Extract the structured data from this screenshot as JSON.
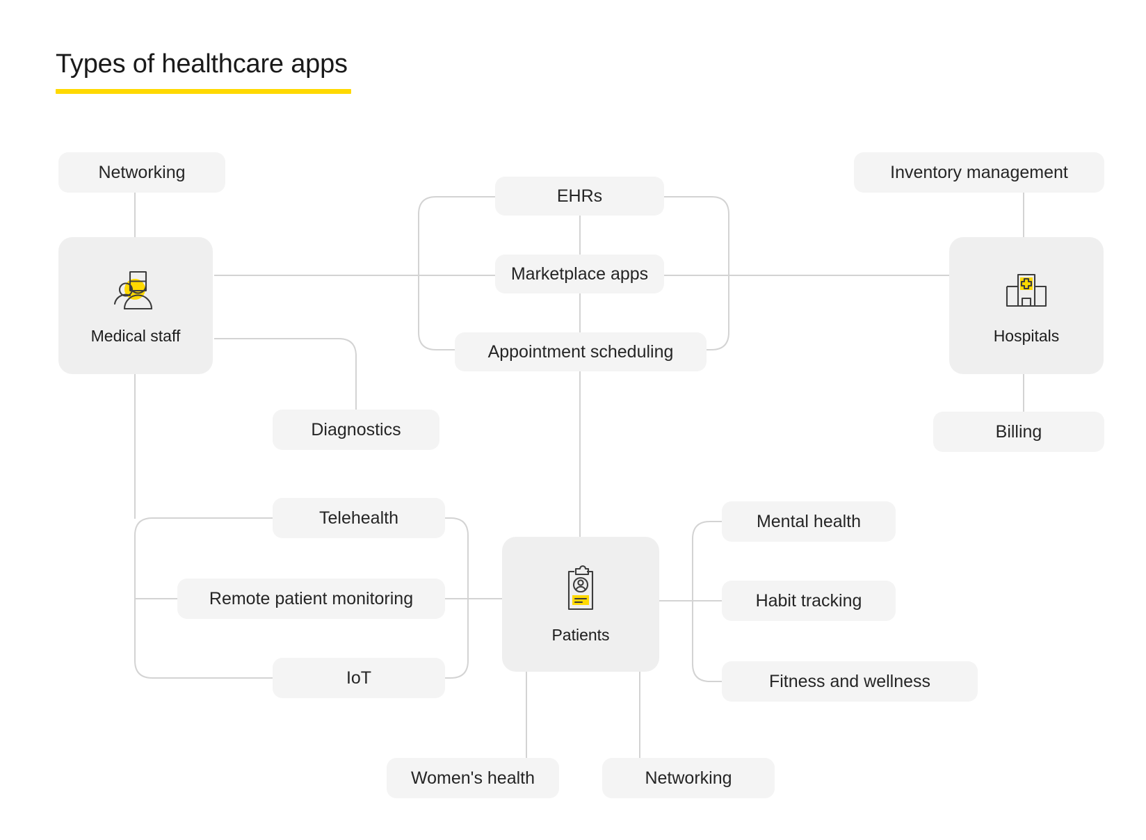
{
  "header": {
    "title": "Types of healthcare apps",
    "accent_color": "#ffd900"
  },
  "colors": {
    "node_bg": "#f4f4f4",
    "hub_bg": "#efefef",
    "connector": "#d3d3d3",
    "accent": "#ffd900",
    "text": "#252525",
    "icon_stroke": "#3c3c3c"
  },
  "diagram": {
    "type": "mind-map",
    "hubs": [
      {
        "id": "medical-staff",
        "label": "Medical staff",
        "icon": "medical-staff-icon"
      },
      {
        "id": "hospitals",
        "label": "Hospitals",
        "icon": "hospital-building-icon"
      },
      {
        "id": "patients",
        "label": "Patients",
        "icon": "patient-clipboard-icon"
      }
    ],
    "nodes": [
      {
        "id": "networking-top",
        "label": "Networking"
      },
      {
        "id": "ehrs",
        "label": "EHRs"
      },
      {
        "id": "inventory-management",
        "label": "Inventory management"
      },
      {
        "id": "marketplace-apps",
        "label": "Marketplace apps"
      },
      {
        "id": "appointment-scheduling",
        "label": "Appointment scheduling"
      },
      {
        "id": "diagnostics",
        "label": "Diagnostics"
      },
      {
        "id": "billing",
        "label": "Billing"
      },
      {
        "id": "telehealth",
        "label": "Telehealth"
      },
      {
        "id": "mental-health",
        "label": "Mental health"
      },
      {
        "id": "remote-patient-monitoring",
        "label": "Remote patient monitoring"
      },
      {
        "id": "habit-tracking",
        "label": "Habit tracking"
      },
      {
        "id": "iot",
        "label": "IoT"
      },
      {
        "id": "fitness-and-wellness",
        "label": "Fitness and wellness"
      },
      {
        "id": "womens-health",
        "label": "Women's health"
      },
      {
        "id": "networking-bottom",
        "label": "Networking"
      }
    ],
    "edges": [
      {
        "from": "networking-top",
        "to": "medical-staff"
      },
      {
        "from": "medical-staff",
        "to": "marketplace-apps"
      },
      {
        "from": "medical-staff",
        "to": "ehrs"
      },
      {
        "from": "medical-staff",
        "to": "appointment-scheduling"
      },
      {
        "from": "medical-staff",
        "to": "diagnostics"
      },
      {
        "from": "medical-staff",
        "to": "telehealth"
      },
      {
        "from": "medical-staff",
        "to": "remote-patient-monitoring"
      },
      {
        "from": "medical-staff",
        "to": "iot"
      },
      {
        "from": "ehrs",
        "to": "hospitals"
      },
      {
        "from": "marketplace-apps",
        "to": "hospitals"
      },
      {
        "from": "appointment-scheduling",
        "to": "hospitals"
      },
      {
        "from": "inventory-management",
        "to": "hospitals"
      },
      {
        "from": "hospitals",
        "to": "billing"
      },
      {
        "from": "marketplace-apps",
        "to": "patients"
      },
      {
        "from": "patients",
        "to": "telehealth"
      },
      {
        "from": "patients",
        "to": "remote-patient-monitoring"
      },
      {
        "from": "patients",
        "to": "iot"
      },
      {
        "from": "patients",
        "to": "mental-health"
      },
      {
        "from": "patients",
        "to": "habit-tracking"
      },
      {
        "from": "patients",
        "to": "fitness-and-wellness"
      },
      {
        "from": "patients",
        "to": "womens-health"
      },
      {
        "from": "patients",
        "to": "networking-bottom"
      }
    ]
  }
}
